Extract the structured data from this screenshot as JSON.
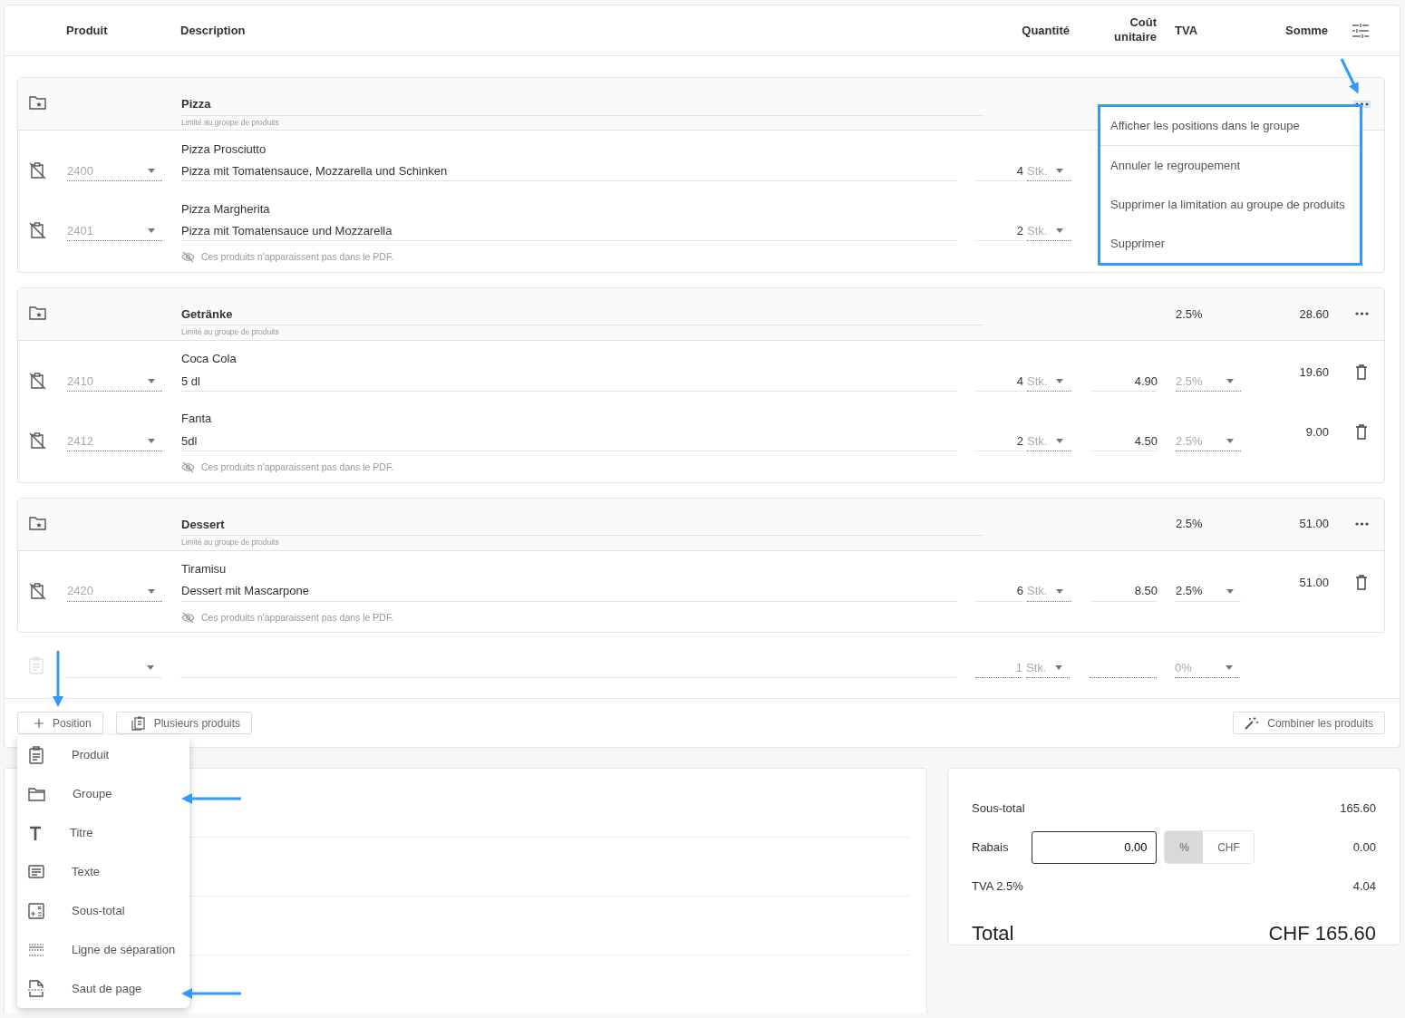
{
  "columns": [
    "Produit",
    "Description",
    "Quantité",
    "Coût unitaire",
    "TVA",
    "Somme"
  ],
  "groups": [
    {
      "name": "Pizza",
      "note": "Limité au groupe de produits",
      "menu_open": true,
      "pdf_note": "Ces produits n'apparaissent pas dans le PDF.",
      "items": [
        {
          "number": "2400",
          "name": "Pizza Prosciutto",
          "description": "Pizza mit Tomatensauce, Mozzarella und Schinken",
          "quantity": "4",
          "unit": "Stk."
        },
        {
          "number": "2401",
          "name": "Pizza Margherita",
          "description": "Pizza mit Tomatensauce und Mozzarella",
          "quantity": "2",
          "unit": "Stk."
        }
      ]
    },
    {
      "name": "Getränke",
      "note": "Limité au groupe de produits",
      "tva": "2.5%",
      "sum": "28.60",
      "menu_open": false,
      "pdf_note": "Ces produits n'apparaissent pas dans le PDF.",
      "items": [
        {
          "number": "2410",
          "name": "Coca Cola",
          "description": "5 dl",
          "quantity": "4",
          "unit": "Stk.",
          "cost": "4.90",
          "tva": "2.5%",
          "tva_inherited": true,
          "sum": "19.60"
        },
        {
          "number": "2412",
          "name": "Fanta",
          "description": "5dl",
          "quantity": "2",
          "unit": "Stk.",
          "cost": "4.50",
          "tva": "2.5%",
          "tva_inherited": true,
          "sum": "9.00"
        }
      ]
    },
    {
      "name": "Dessert",
      "note": "Limité au groupe de produits",
      "tva": "2.5%",
      "sum": "51.00",
      "menu_open": false,
      "pdf_note": "Ces produits n'apparaissent pas dans le PDF.",
      "items": [
        {
          "number": "2420",
          "name": "Tiramisu",
          "description": "Dessert mit Mascarpone",
          "quantity": "6",
          "unit": "Stk.",
          "cost": "8.50",
          "tva": "2.5%",
          "tva_inherited": false,
          "sum": "51.00"
        }
      ]
    }
  ],
  "context_menu": {
    "items": [
      "Afficher les positions dans le groupe",
      "Annuler le regroupement",
      "Supprimer la limitation au groupe de produits",
      "Supprimer"
    ]
  },
  "new_row": {
    "quantity": "1",
    "unit": "Stk.",
    "tva": "0%"
  },
  "buttons": {
    "position": "Position",
    "multiple": "Plusieurs produits",
    "combine": "Combiner les produits"
  },
  "add_menu": {
    "open": true,
    "items": [
      {
        "label": "Produit",
        "kind": "product"
      },
      {
        "label": "Groupe",
        "kind": "group"
      },
      {
        "label": "Titre",
        "kind": "title"
      },
      {
        "label": "Texte",
        "kind": "text"
      },
      {
        "label": "Sous-total",
        "kind": "subtotal"
      },
      {
        "label": "Ligne de séparation",
        "kind": "separator"
      },
      {
        "label": "Saut de page",
        "kind": "page-break"
      }
    ]
  },
  "totals": {
    "subtotal_label": "Sous-total",
    "subtotal": "165.60",
    "discount_label": "Rabais",
    "discount_input": "0.00",
    "discount_units": [
      {
        "label": "%",
        "selected": true
      },
      {
        "label": "CHF",
        "selected": false
      }
    ],
    "discount": "0.00",
    "tax_label": "TVA 2.5%",
    "tax": "4.04",
    "total_label": "Total",
    "total": "CHF 165.60"
  }
}
